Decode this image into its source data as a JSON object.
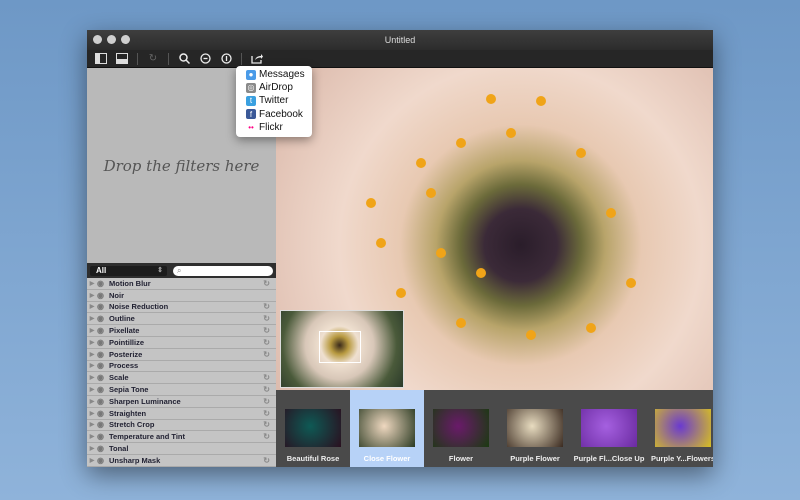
{
  "window": {
    "title": "Untitled"
  },
  "toolbar": {
    "buttons": [
      {
        "icon": "sidebar-icon"
      },
      {
        "icon": "bottom-panel-icon"
      },
      {
        "icon": "rotate-icon"
      },
      {
        "icon": "zoom-icon"
      },
      {
        "icon": "zoom-out-icon"
      },
      {
        "icon": "actual-size-icon"
      },
      {
        "icon": "share-icon"
      }
    ]
  },
  "share_menu": {
    "items": [
      {
        "label": "Messages",
        "icon": "messages-icon",
        "color": "#4a9be8"
      },
      {
        "label": "AirDrop",
        "icon": "airdrop-icon",
        "color": "#8a8a8a"
      },
      {
        "label": "Twitter",
        "icon": "twitter-icon",
        "color": "#3aa0e0"
      },
      {
        "label": "Facebook",
        "icon": "facebook-icon",
        "color": "#3b5998"
      },
      {
        "label": "Flickr",
        "icon": "flickr-icon",
        "color": "#ff0084"
      }
    ]
  },
  "drop_area": {
    "text": "Drop the filters here"
  },
  "filter_bar": {
    "category": "All",
    "search_placeholder": ""
  },
  "filters": [
    {
      "name": "Motion Blur",
      "reset": true
    },
    {
      "name": "Noir",
      "reset": false
    },
    {
      "name": "Noise Reduction",
      "reset": true
    },
    {
      "name": "Outline",
      "reset": true
    },
    {
      "name": "Pixellate",
      "reset": true
    },
    {
      "name": "Pointillize",
      "reset": true
    },
    {
      "name": "Posterize",
      "reset": true
    },
    {
      "name": "Process",
      "reset": false
    },
    {
      "name": "Scale",
      "reset": true
    },
    {
      "name": "Sepia Tone",
      "reset": true
    },
    {
      "name": "Sharpen Luminance",
      "reset": true
    },
    {
      "name": "Straighten",
      "reset": true
    },
    {
      "name": "Stretch Crop",
      "reset": true
    },
    {
      "name": "Temperature and Tint",
      "reset": true
    },
    {
      "name": "Tonal",
      "reset": false
    },
    {
      "name": "Unsharp Mask",
      "reset": true
    }
  ],
  "thumbnails": [
    {
      "caption": "Beautiful Rose",
      "selected": false,
      "colors": [
        "#0e5a55",
        "#2a0f1f"
      ]
    },
    {
      "caption": "Close Flower",
      "selected": true,
      "colors": [
        "#efd8c0",
        "#2a3a22"
      ]
    },
    {
      "caption": "Flower",
      "selected": false,
      "colors": [
        "#6a1a6a",
        "#1a3a10"
      ]
    },
    {
      "caption": "Purple Flower",
      "selected": false,
      "colors": [
        "#e8dcc0",
        "#3a2a20"
      ]
    },
    {
      "caption": "Purple Fl...Close Up",
      "selected": false,
      "colors": [
        "#a560e0",
        "#6a2aa0"
      ]
    },
    {
      "caption": "Purple Y...Flowers",
      "selected": false,
      "colors": [
        "#6a3ad0",
        "#d8c020"
      ]
    }
  ]
}
